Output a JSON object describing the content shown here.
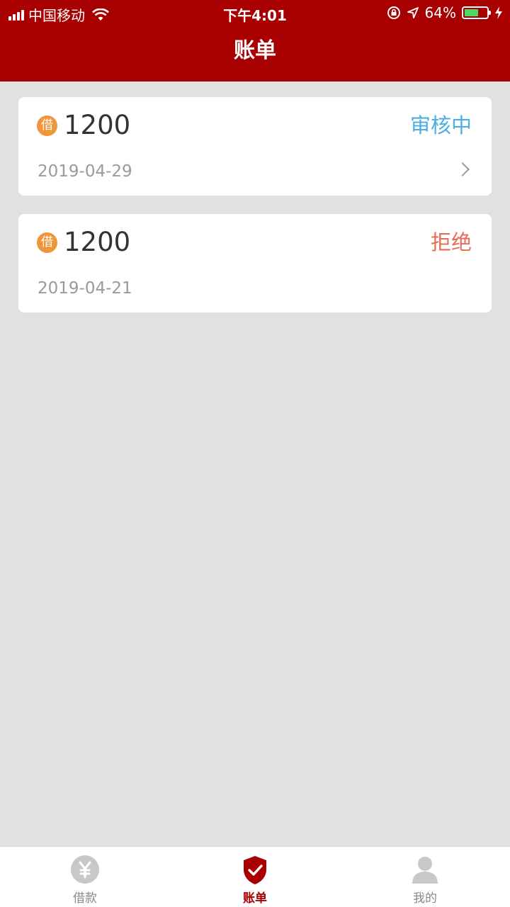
{
  "status_bar": {
    "carrier": "中国移动",
    "time": "下午4:01",
    "battery": "64%",
    "battery_fraction": 0.64
  },
  "header": {
    "title": "账单"
  },
  "bills": [
    {
      "badge": "借",
      "amount": "1200",
      "status": "审核中",
      "date": "2019-04-29",
      "has_arrow": true,
      "status_color": "#4aaee2"
    },
    {
      "badge": "借",
      "amount": "1200",
      "status": "拒绝",
      "date": "2019-04-21",
      "has_arrow": false,
      "status_color": "#e56d55"
    }
  ],
  "tabs": [
    {
      "label": "借款",
      "icon": "yen-icon",
      "active": false
    },
    {
      "label": "账单",
      "icon": "shield-check-icon",
      "active": true
    },
    {
      "label": "我的",
      "icon": "person-icon",
      "active": false
    }
  ],
  "colors": {
    "brand": "#a80000",
    "background": "#e1e1e1",
    "badge": "#f0953a"
  }
}
